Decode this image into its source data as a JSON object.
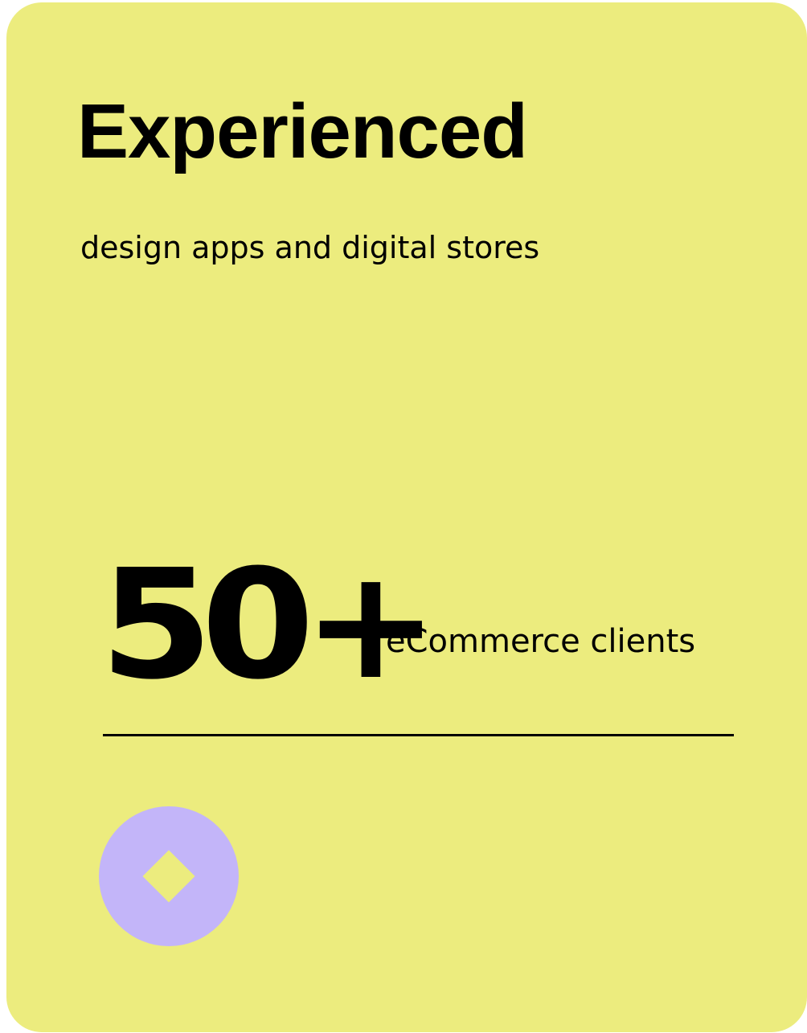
{
  "card": {
    "title": "Experienced",
    "subtitle": "design apps and digital stores",
    "stat": {
      "value": "50+",
      "label": "eCommerce clients"
    },
    "badge": {
      "icon": "diamond-icon"
    }
  },
  "colors": {
    "card_background": "#ECEC7E",
    "badge_background": "#C3B5F9",
    "text": "#000000"
  }
}
